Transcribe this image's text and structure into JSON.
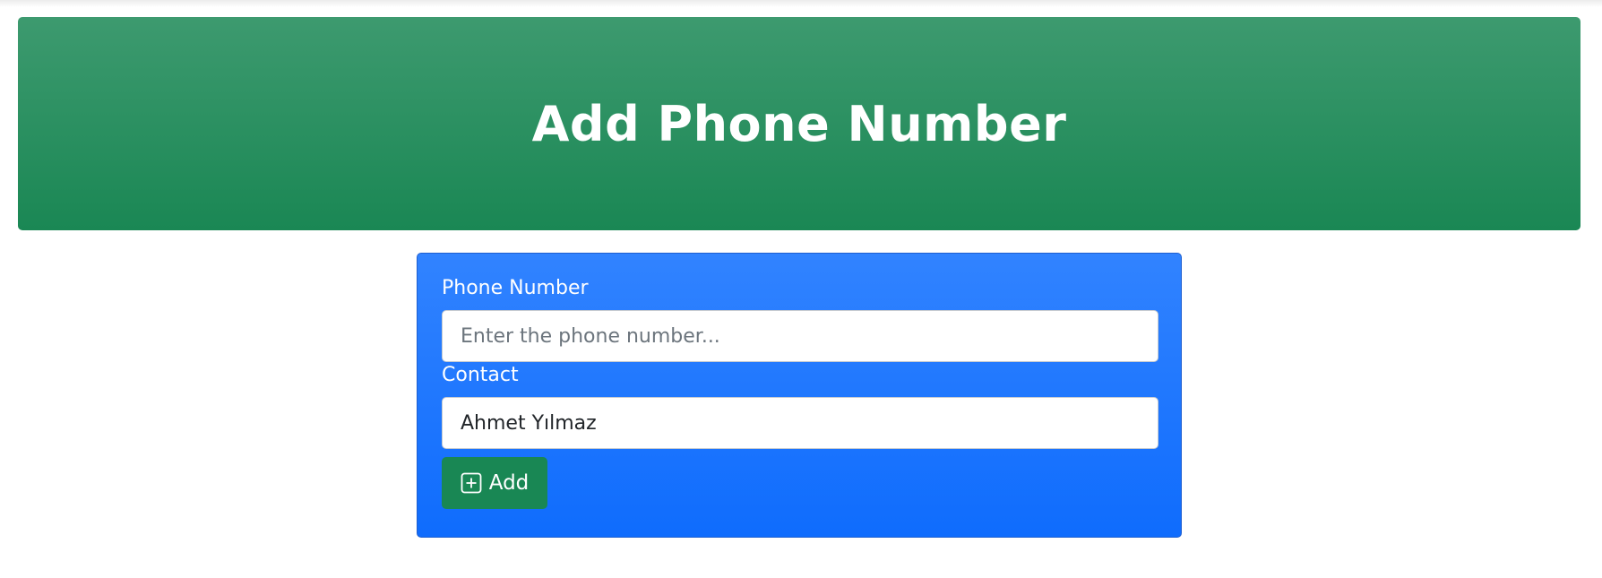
{
  "header": {
    "title": "Add Phone Number"
  },
  "form": {
    "phone_label": "Phone Number",
    "phone_placeholder": "Enter the phone number...",
    "phone_value": "",
    "contact_label": "Contact",
    "contact_value": "Ahmet Yılmaz",
    "add_button_label": "Add",
    "add_button_icon": "plus-square-icon"
  },
  "colors": {
    "header_green": "#198754",
    "card_blue": "#0d6efd",
    "button_green": "#198754"
  }
}
